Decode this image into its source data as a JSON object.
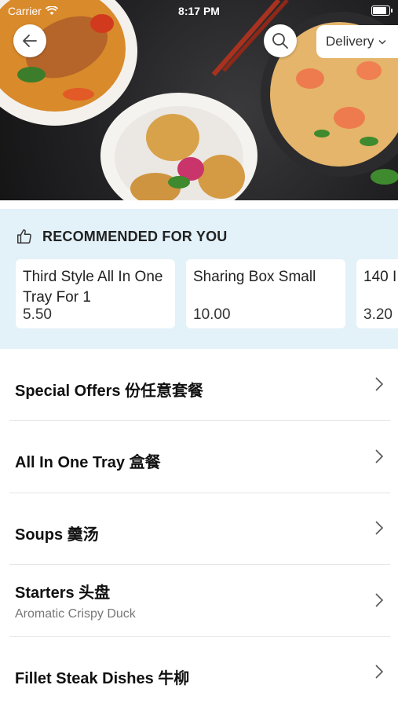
{
  "status_bar": {
    "carrier": "Carrier",
    "time": "8:17 PM"
  },
  "header": {
    "delivery_label": "Delivery"
  },
  "recommended": {
    "title": "RECOMMENDED FOR YOU",
    "items": [
      {
        "name": "Third Style All In One Tray For 1",
        "price": "5.50"
      },
      {
        "name": "Sharing Box Small",
        "price": "10.00"
      },
      {
        "name": "140 I",
        "price": "3.20"
      }
    ]
  },
  "categories": [
    {
      "title": "Special Offers 份任意套餐",
      "subtitle": ""
    },
    {
      "title": "All In One Tray 盒餐",
      "subtitle": ""
    },
    {
      "title": "Soups 羹汤",
      "subtitle": ""
    },
    {
      "title": "Starters 头盘",
      "subtitle": "Aromatic Crispy Duck"
    },
    {
      "title": "Fillet Steak Dishes 牛柳",
      "subtitle": ""
    }
  ],
  "colors": {
    "recommended_bg": "#e3f1f8",
    "divider": "#e6e6e6"
  }
}
